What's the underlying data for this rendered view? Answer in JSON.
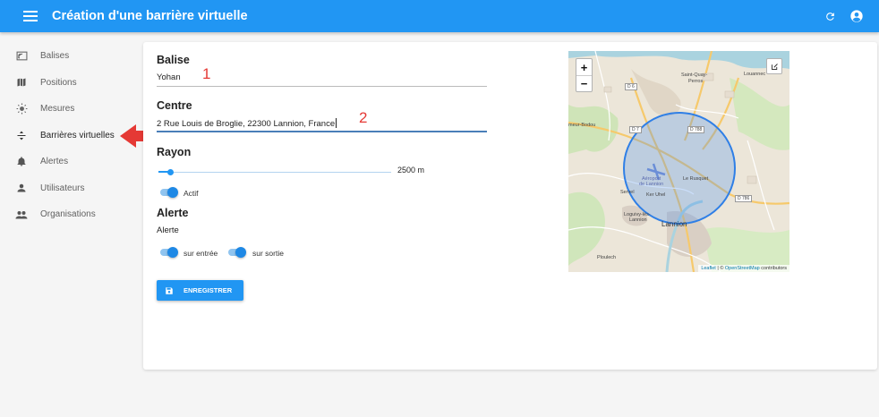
{
  "app": {
    "title": "Création d'une barrière virtuelle"
  },
  "icons": {
    "menu": "menu-icon",
    "refresh": "refresh-icon",
    "account": "account-circle-icon",
    "save": "floppy-disk-icon",
    "draw": "edit-square-icon"
  },
  "colors": {
    "primary": "#2196f3",
    "callout": "#e53935",
    "circle": "#2f7fe6"
  },
  "sidebar": {
    "items": [
      {
        "label": "Balises",
        "icon": "cell-tower-icon"
      },
      {
        "label": "Positions",
        "icon": "map-icon"
      },
      {
        "label": "Mesures",
        "icon": "sun-icon"
      },
      {
        "label": "Barrières virtuelles",
        "icon": "fence-icon",
        "active": true
      },
      {
        "label": "Alertes",
        "icon": "bell-icon"
      },
      {
        "label": "Utilisateurs",
        "icon": "person-icon"
      },
      {
        "label": "Organisations",
        "icon": "people-icon"
      }
    ]
  },
  "form": {
    "balise": {
      "label": "Balise",
      "value": "Yohan",
      "callout": "1"
    },
    "centre": {
      "label": "Centre",
      "value": "2 Rue Louis de Broglie, 22300 Lannion, France",
      "callout": "2"
    },
    "rayon": {
      "label": "Rayon",
      "value_text": "2500 m",
      "slider_fraction": 0.05
    },
    "actif": {
      "label": "Actif",
      "checked": true
    },
    "alerte": {
      "label": "Alerte",
      "subtitle": "Alerte",
      "entree": {
        "label": "sur entrée",
        "checked": true
      },
      "sortie": {
        "label": "sur sortie",
        "checked": true
      }
    },
    "save_label": "ENREGISTRER"
  },
  "map": {
    "zoom_in": "+",
    "zoom_out": "−",
    "attribution": {
      "leaflet": "Leaflet",
      "sep": " | © ",
      "osm": "OpenStreetMap",
      "suffix": " contributors"
    },
    "labels": {
      "saint_quay": "Saint-Quay-",
      "perros": "Perros",
      "louannec": "Louannec",
      "bodou": "meur-Bodou",
      "aeroport_1": "Aéroport",
      "aeroport_2": "de Lannion",
      "le_rusquet": "Le Rusquet",
      "servel": "Servel",
      "ker_uhel": "Ker Uhel",
      "loguivy_1": "Loguivy-lès-",
      "loguivy_2": "Lannion",
      "lannion": "Lannion",
      "ploulech": "Ploulech",
      "d6": "D 6",
      "d788_top": "D 788",
      "d788_left": "D 7",
      "d786": "D 786"
    }
  }
}
